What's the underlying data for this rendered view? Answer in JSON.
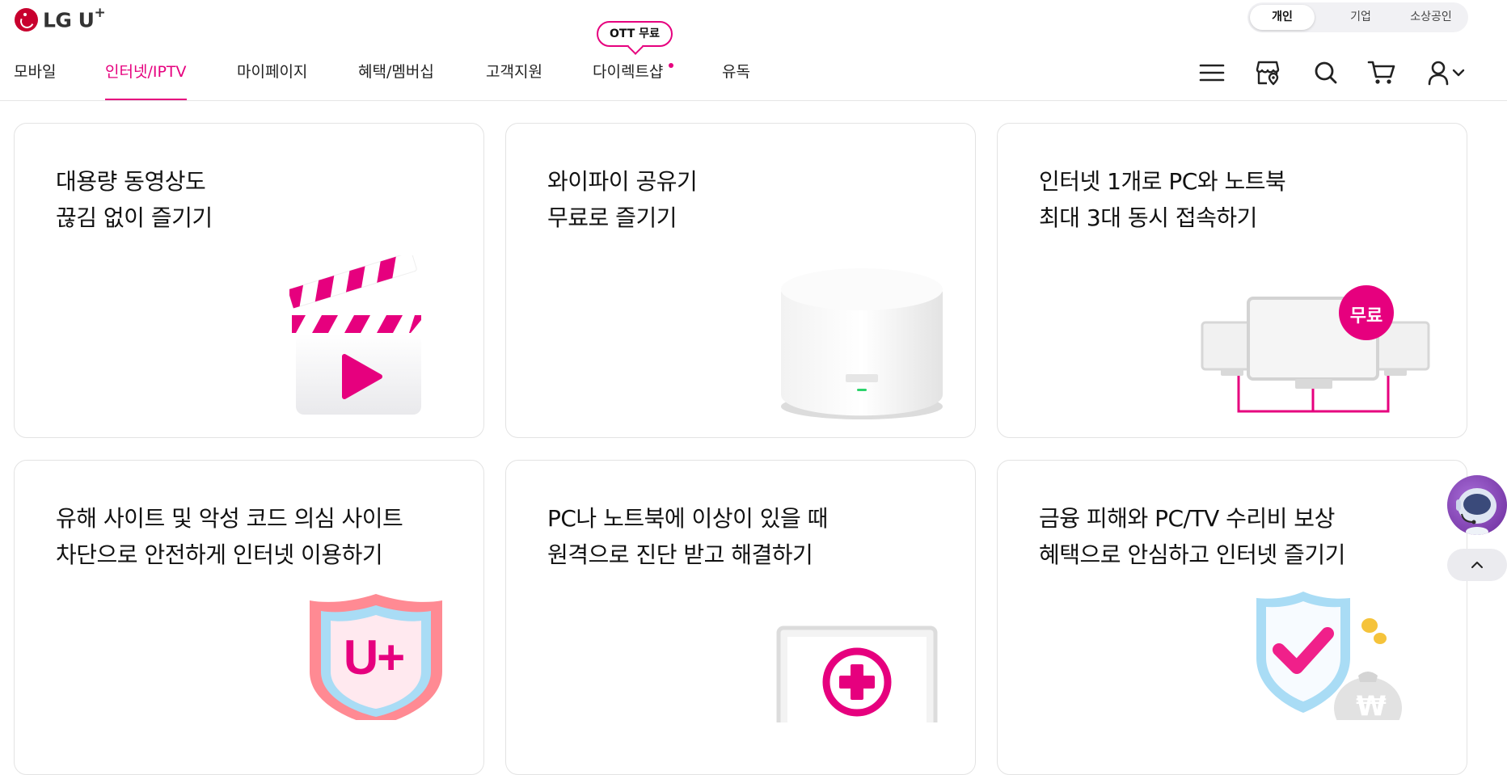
{
  "brand": {
    "name": "LG U",
    "superscript": "+"
  },
  "segment": {
    "items": [
      "개인",
      "기업",
      "소상공인"
    ],
    "selected": "개인"
  },
  "nav": {
    "items": [
      "모바일",
      "인터넷/IPTV",
      "마이페이지",
      "혜택/멤버십",
      "고객지원",
      "다이렉트샵",
      "유독"
    ],
    "active": "인터넷/IPTV"
  },
  "ott_bubble": {
    "label": "OTT 무료"
  },
  "header_icons": [
    "menu-icon",
    "store-location-icon",
    "search-icon",
    "cart-icon",
    "user-icon",
    "chevron-down-icon"
  ],
  "cards": [
    {
      "line1": "대용량 동영상도",
      "line2": "끊김 없이 즐기기",
      "art": "clapperboard-icon"
    },
    {
      "line1": "와이파이 공유기",
      "line2": "무료로 즐기기",
      "art": "wifi-router-icon"
    },
    {
      "line1": "인터넷 1개로 PC와 노트북",
      "line2": "최대 3대 동시 접속하기",
      "art": "multi-monitor-icon",
      "badge": "무료"
    },
    {
      "line1": "유해 사이트 및 악성 코드 의심 사이트",
      "line2": "차단으로 안전하게 인터넷 이용하기",
      "art": "uplus-shield-icon",
      "badge_text": "U+"
    },
    {
      "line1": "PC나 노트북에 이상이 있을 때",
      "line2": "원격으로 진단 받고 해결하기",
      "art": "monitor-plus-icon"
    },
    {
      "line1": "금융 피해와 PC/TV 수리비 보상",
      "line2": "혜택으로 안심하고 인터넷 즐기기",
      "art": "check-shield-money-icon",
      "money_symbol": "₩"
    }
  ],
  "colors": {
    "accent": "#e6007e",
    "brand_red": "#c8002e",
    "border": "#e3e3e3"
  }
}
